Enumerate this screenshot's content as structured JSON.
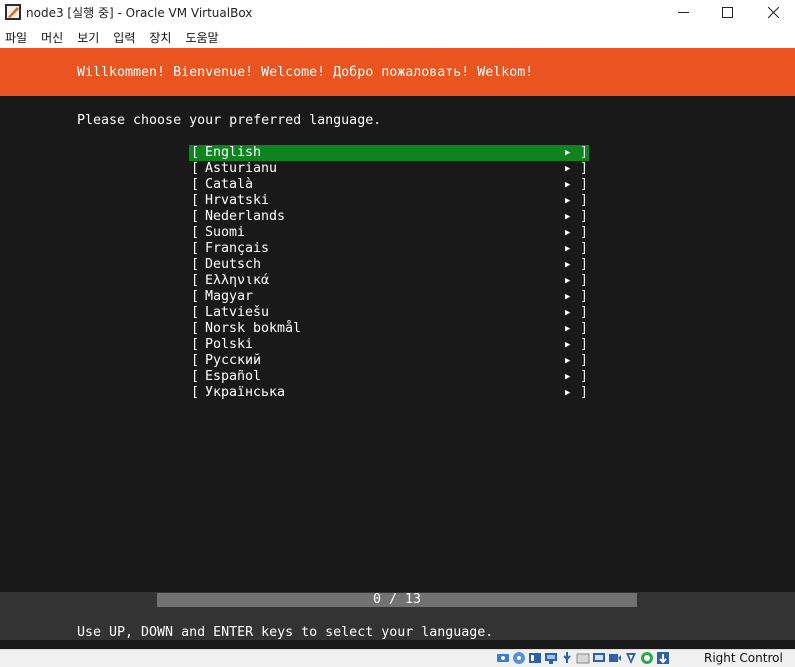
{
  "window": {
    "title": "node3 [실행 중] - Oracle VM VirtualBox",
    "controls": [
      "minimize",
      "maximize",
      "close"
    ]
  },
  "menu": [
    "파일",
    "머신",
    "보기",
    "입력",
    "장치",
    "도움말"
  ],
  "installer": {
    "welcome": "Willkommen! Bienvenue! Welcome! Добро пожаловать! Welkom!",
    "prompt": "Please choose your preferred language.",
    "languages": [
      "English",
      "Asturianu",
      "Català",
      "Hrvatski",
      "Nederlands",
      "Suomi",
      "Français",
      "Deutsch",
      "Ελληνικά",
      "Magyar",
      "Latviešu",
      "Norsk bokmål",
      "Polski",
      "Русский",
      "Español",
      "Українська"
    ],
    "selected_index": 0,
    "bracket_open": "[",
    "bracket_close": "]",
    "arrow": "▶",
    "progress": "0 / 13",
    "help": "Use UP, DOWN and ENTER keys to select your language."
  },
  "statusbar": {
    "icons": [
      "hard-disk-icon",
      "optical-disk-icon",
      "audio-icon",
      "network-icon",
      "usb-icon",
      "shared-folder-icon",
      "display-icon",
      "recording-icon",
      "virtualization-icon",
      "cpu-icon",
      "mouse-integration-icon"
    ],
    "host_key": "Right Control"
  },
  "colors": {
    "header_orange": "#e95420",
    "selection_green": "#0e8420",
    "screen_background": "#191919"
  }
}
